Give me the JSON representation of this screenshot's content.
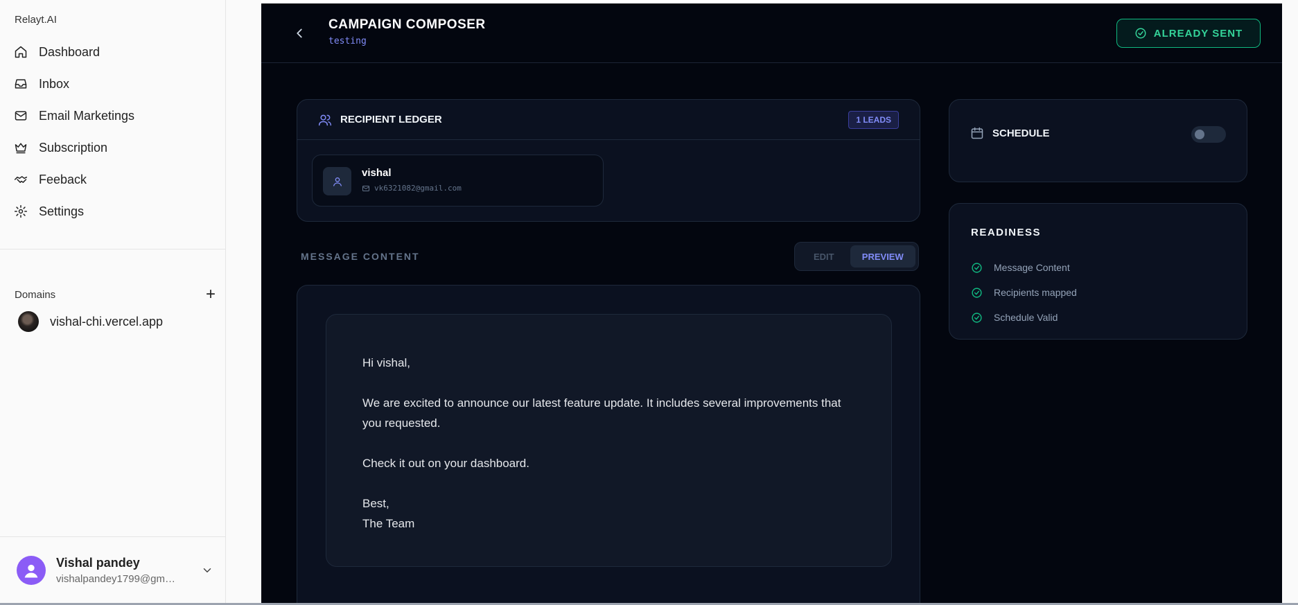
{
  "sidebar": {
    "brand": "Relayt.AI",
    "nav": [
      {
        "label": "Dashboard",
        "icon": "home-icon"
      },
      {
        "label": "Inbox",
        "icon": "inbox-icon"
      },
      {
        "label": "Email Marketings",
        "icon": "mail-icon"
      },
      {
        "label": "Subscription",
        "icon": "crown-icon"
      },
      {
        "label": "Feeback",
        "icon": "handshake-icon"
      },
      {
        "label": "Settings",
        "icon": "gear-icon"
      }
    ],
    "domains_label": "Domains",
    "domains": [
      {
        "name": "vishal-chi.vercel.app"
      }
    ],
    "user": {
      "name": "Vishal pandey",
      "email": "vishalpandey1799@gmai..."
    }
  },
  "header": {
    "title": "CAMPAIGN COMPOSER",
    "subtitle": "testing",
    "status_button": "ALREADY SENT"
  },
  "ledger": {
    "title": "RECIPIENT LEDGER",
    "badge": "1 LEADS",
    "recipients": [
      {
        "name": "vishal",
        "email": "vk6321082@gmail.com"
      }
    ]
  },
  "message": {
    "label": "MESSAGE CONTENT",
    "tabs": {
      "edit": "EDIT",
      "preview": "PREVIEW",
      "active": "preview"
    },
    "body": {
      "greeting": "Hi vishal,",
      "paragraph1": "We are excited to announce our latest feature update. It includes several improvements that you requested.",
      "paragraph2": "Check it out on your dashboard.",
      "signoff": "Best,",
      "signature": "The Team"
    }
  },
  "schedule": {
    "title": "SCHEDULE",
    "enabled": false
  },
  "readiness": {
    "title": "READINESS",
    "items": [
      "Message Content",
      "Recipients mapped",
      "Schedule Valid"
    ]
  },
  "colors": {
    "accent": "#818cf8",
    "success": "#34d399",
    "background": "#03060f"
  }
}
